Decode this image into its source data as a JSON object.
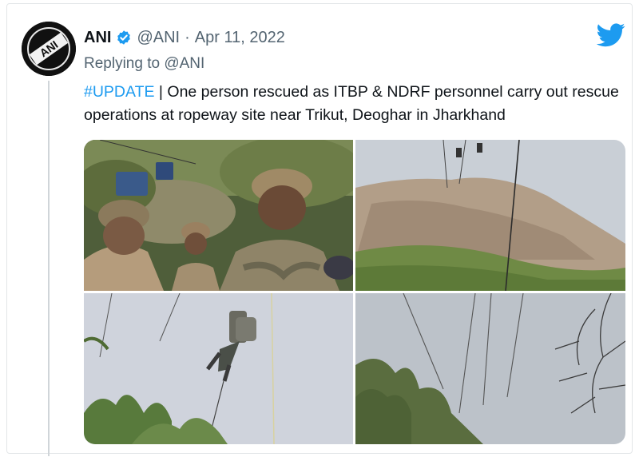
{
  "tweet": {
    "author_name": "ANI",
    "handle": "@ANI",
    "separator": "·",
    "date": "Apr 11, 2022",
    "replying_prefix": "Replying to ",
    "replying_to": "@ANI",
    "hashtag": "#UPDATE",
    "text_rest": " | One person rescued as ITBP & NDRF personnel carry out rescue operations at ropeway site near Trikut, Deoghar in Jharkhand",
    "verified": true,
    "avatar_logo_text": "ANI"
  },
  "media": [
    {
      "name": "photo-soldiers-cable-car"
    },
    {
      "name": "photo-hill-ropeway"
    },
    {
      "name": "photo-rescuer-on-rope"
    },
    {
      "name": "photo-cables-trees"
    }
  ],
  "icons": {
    "verified": "verified-badge-icon",
    "brand": "twitter-bird-icon"
  },
  "colors": {
    "accent": "#1d9bf0",
    "text": "#0f1419",
    "muted": "#536471"
  }
}
